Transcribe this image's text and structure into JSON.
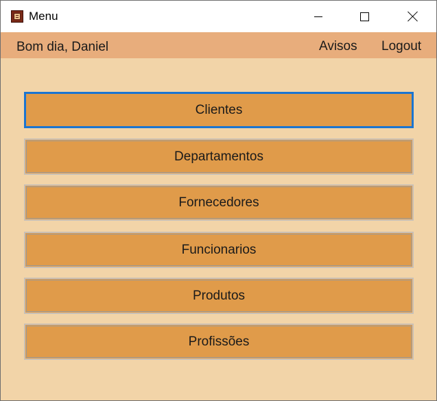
{
  "window": {
    "title": "Menu",
    "icon": "app-window-icon",
    "controls": {
      "minimize": "minimize-icon",
      "maximize": "maximize-icon",
      "close": "close-icon"
    }
  },
  "menustrip": {
    "greeting": "Bom dia, Daniel",
    "avisos": "Avisos",
    "logout": "Logout"
  },
  "menu": {
    "buttons": [
      {
        "label": "Clientes",
        "focused": true
      },
      {
        "label": "Departamentos",
        "focused": false
      },
      {
        "label": "Fornecedores",
        "focused": false
      },
      {
        "label": "Funcionarios",
        "focused": false
      },
      {
        "label": "Produtos",
        "focused": false
      },
      {
        "label": "Profissões",
        "focused": false
      }
    ]
  },
  "colors": {
    "form_background": "#f2d4a8",
    "menustrip_background": "#e8ad7c",
    "button_background": "#e09b4a",
    "focus_border": "#1a75d2"
  }
}
